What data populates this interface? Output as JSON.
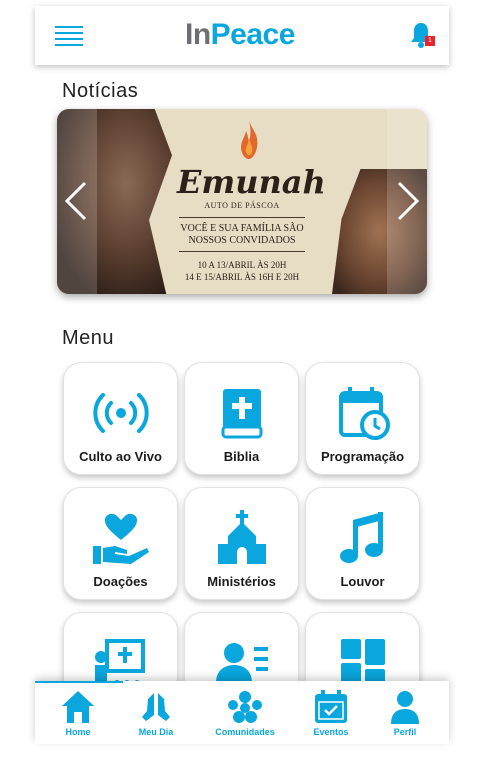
{
  "header": {
    "logo_in": "In",
    "logo_peace": "Peace",
    "notification_count": "1"
  },
  "news": {
    "title": "Notícias",
    "banner": {
      "title": "Emunah",
      "subtitle": "AUTO DE PÁSCOA",
      "tagline_1": "VOCÊ E SUA FAMÍLIA SÃO",
      "tagline_2": "NOSSOS CONVIDADOS",
      "date_1": "10 A 13/ABRIL ÀS 20H",
      "date_2": "14 E 15/ABRIL ÀS 16H E 20H"
    }
  },
  "menu": {
    "title": "Menu",
    "items": [
      {
        "label": "Culto ao Vivo",
        "icon": "broadcast-icon"
      },
      {
        "label": "Biblia",
        "icon": "bible-icon"
      },
      {
        "label": "Programação",
        "icon": "calendar-clock-icon"
      },
      {
        "label": "Doações",
        "icon": "donation-hand-heart-icon"
      },
      {
        "label": "Ministérios",
        "icon": "church-icon"
      },
      {
        "label": "Louvor",
        "icon": "music-note-icon"
      },
      {
        "label": "",
        "icon": "teaching-board-icon"
      },
      {
        "label": "",
        "icon": "contact-list-icon"
      },
      {
        "label": "",
        "icon": "dashboard-grid-icon"
      }
    ]
  },
  "tabbar": {
    "tabs": [
      {
        "label": "Home",
        "icon": "home-icon"
      },
      {
        "label": "Meu Dia",
        "icon": "praying-hands-icon"
      },
      {
        "label": "Comunidades",
        "icon": "community-icon"
      },
      {
        "label": "Eventos",
        "icon": "calendar-check-icon"
      },
      {
        "label": "Perfil",
        "icon": "user-icon"
      }
    ]
  },
  "colors": {
    "accent": "#0aa7de",
    "logo_grey": "#6d6f74",
    "badge": "#e8232d"
  }
}
